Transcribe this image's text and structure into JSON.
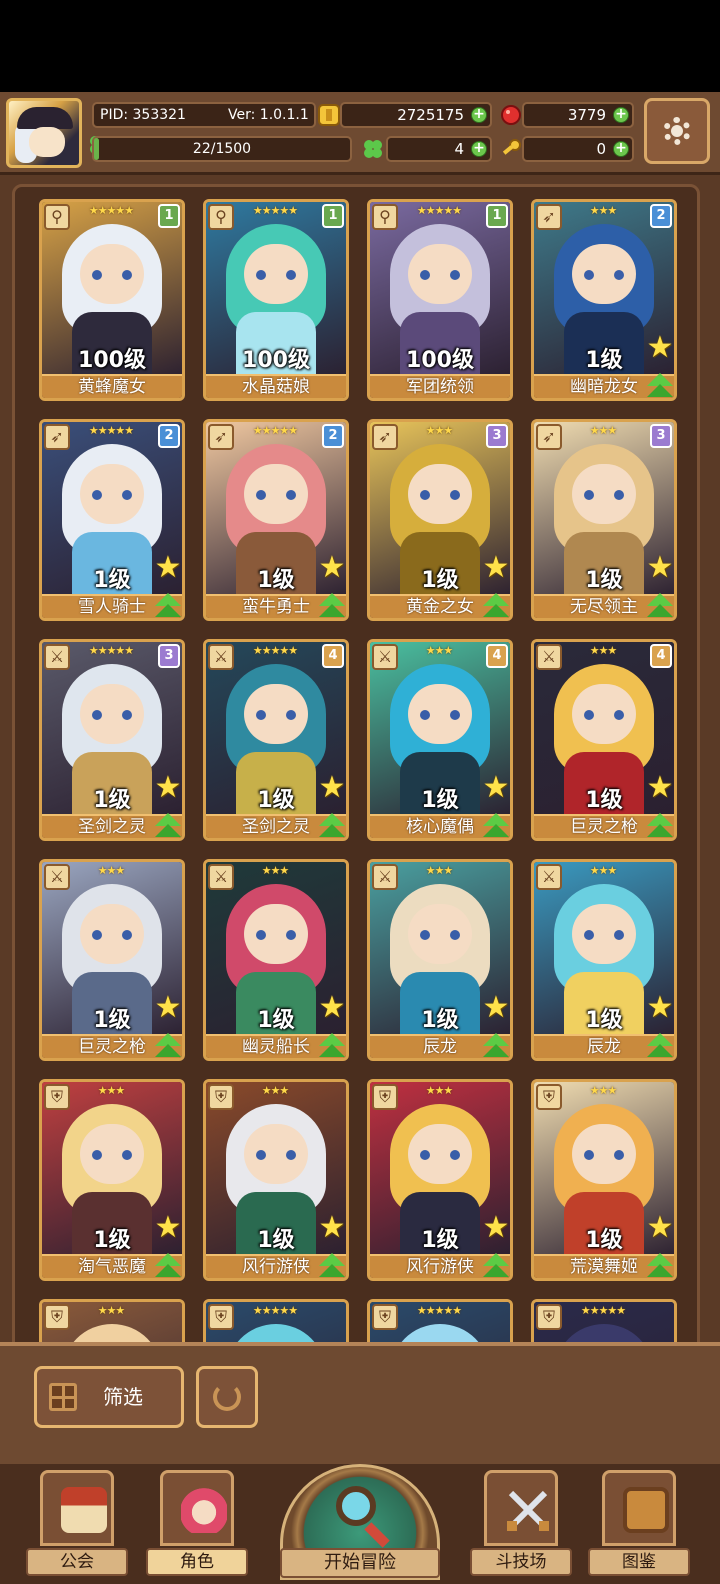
{
  "player": {
    "pid": "PID: 353321",
    "version": "Ver: 1.0.1.1",
    "level_progress": "22/1500",
    "level_fraction": 0.0147
  },
  "resources": {
    "gold": "2725175",
    "ruby": "3779",
    "clover": "4",
    "key": "0"
  },
  "colors": {
    "tier1": "#6aa84f",
    "tier2": "#4a8fd6",
    "tier3": "#9b7bd0",
    "tier4": "#d9a24e",
    "card_border": "#d9a24e",
    "name_plate": "#c98a3d"
  },
  "heroes": [
    {
      "stars": "★★★★★",
      "tier": "1",
      "level": "100级",
      "name": "黄蜂魔女",
      "weapon": "wand-icon",
      "art": [
        "#e9eef5",
        "#2e2a3c",
        "#d7a246"
      ]
    },
    {
      "stars": "★★★★★",
      "tier": "1",
      "level": "100级",
      "name": "水晶菇娘",
      "weapon": "wand-icon",
      "art": [
        "#47c9b5",
        "#a8e4ef",
        "#2f7aa0"
      ]
    },
    {
      "stars": "★★★★★",
      "tier": "1",
      "level": "100级",
      "name": "军团统领",
      "weapon": "wand-icon",
      "art": [
        "#c4c0dc",
        "#5b4a7a",
        "#7a6aa0"
      ]
    },
    {
      "stars": "★★★",
      "tier": "2",
      "level": "1级",
      "name": "幽暗龙女",
      "weapon": "bow-icon",
      "art": [
        "#2d5fa8",
        "#1b2f55",
        "#3e7a8a"
      ],
      "up": true
    },
    {
      "stars": "★★★★★",
      "tier": "2",
      "level": "1级",
      "name": "雪人骑士",
      "weapon": "bow-icon",
      "art": [
        "#e8edf4",
        "#6ab7e0",
        "#3a4f7a"
      ],
      "up": true
    },
    {
      "stars": "★★★★★",
      "tier": "2",
      "level": "1级",
      "name": "蛮牛勇士",
      "weapon": "bow-icon",
      "art": [
        "#e58a8a",
        "#8a5a3a",
        "#f0c8a0"
      ],
      "up": true
    },
    {
      "stars": "★★★",
      "tier": "3",
      "level": "1级",
      "name": "黄金之女",
      "weapon": "bow-icon",
      "art": [
        "#d6ae3c",
        "#8a6a1c",
        "#e8c45a"
      ],
      "up": true
    },
    {
      "stars": "★★★",
      "tier": "3",
      "level": "1级",
      "name": "无尽领主",
      "weapon": "bow-icon",
      "art": [
        "#e6c48a",
        "#b08850",
        "#f0dcb0"
      ],
      "up": true
    },
    {
      "stars": "★★★★★",
      "tier": "3",
      "level": "1级",
      "name": "圣剑之灵",
      "weapon": "sword-icon",
      "art": [
        "#dfe6ee",
        "#c9a25a",
        "#5a5a6a"
      ],
      "up": true
    },
    {
      "stars": "★★★★★",
      "tier": "4",
      "level": "1级",
      "name": "圣剑之灵",
      "weapon": "sword-icon",
      "art": [
        "#2f8aa0",
        "#c7b04a",
        "#24485a"
      ],
      "up": true
    },
    {
      "stars": "★★★",
      "tier": "4",
      "level": "1级",
      "name": "核心魔偶",
      "weapon": "sword-icon",
      "art": [
        "#2fb0d6",
        "#1e3a4a",
        "#4ac0a0"
      ],
      "up": true
    },
    {
      "stars": "★★★",
      "tier": "4",
      "level": "1级",
      "name": "巨灵之枪",
      "weapon": "sword-icon",
      "art": [
        "#f0c050",
        "#b0252a",
        "#2a2a3a"
      ],
      "up": true
    },
    {
      "stars": "★★★",
      "tier": "",
      "level": "1级",
      "name": "巨灵之枪",
      "weapon": "sword-icon",
      "art": [
        "#dfe3ea",
        "#5a6a8a",
        "#9aa6c0"
      ],
      "up": true
    },
    {
      "stars": "★★★",
      "tier": "",
      "level": "1级",
      "name": "幽灵船长",
      "weapon": "sword-icon",
      "art": [
        "#d04a6a",
        "#3a8a60",
        "#1f3a3a"
      ],
      "up": true
    },
    {
      "stars": "★★★",
      "tier": "",
      "level": "1级",
      "name": "辰龙",
      "weapon": "sword-icon",
      "art": [
        "#ecdcc0",
        "#2a8ab0",
        "#4aa0a0"
      ],
      "up": true
    },
    {
      "stars": "★★★",
      "tier": "",
      "level": "1级",
      "name": "辰龙",
      "weapon": "sword-icon",
      "art": [
        "#6acfe0",
        "#f0d060",
        "#3a9ac0"
      ],
      "up": true
    },
    {
      "stars": "★★★",
      "tier": "",
      "level": "1级",
      "name": "淘气恶魔",
      "weapon": "shield-icon",
      "art": [
        "#f2d48a",
        "#5a3030",
        "#c04040"
      ],
      "up": true
    },
    {
      "stars": "★★★",
      "tier": "",
      "level": "1级",
      "name": "风行游侠",
      "weapon": "shield-icon",
      "art": [
        "#e8e8ec",
        "#2a6a50",
        "#8a4a2a"
      ],
      "up": true
    },
    {
      "stars": "★★★",
      "tier": "",
      "level": "1级",
      "name": "风行游侠",
      "weapon": "shield-icon",
      "art": [
        "#f0c050",
        "#2a2a40",
        "#c03040"
      ],
      "up": true
    },
    {
      "stars": "★★★",
      "tier": "",
      "level": "1级",
      "name": "荒漠舞姬",
      "weapon": "shield-icon",
      "art": [
        "#f0b050",
        "#c0402a",
        "#f0dcb0"
      ],
      "up": true
    },
    {
      "stars": "★★★",
      "tier": "",
      "level": "",
      "name": "",
      "weapon": "shield-icon",
      "art": [
        "#f0d0a0",
        "#d06060",
        "#8a5a3a"
      ]
    },
    {
      "stars": "★★★★★",
      "tier": "",
      "level": "",
      "name": "",
      "weapon": "shield-icon",
      "art": [
        "#6acfe0",
        "#2a6a90",
        "#2a4a6a"
      ]
    },
    {
      "stars": "★★★★★",
      "tier": "",
      "level": "",
      "name": "",
      "weapon": "shield-icon",
      "art": [
        "#9ad8f0",
        "#3a6a90",
        "#2a4a6a"
      ]
    },
    {
      "stars": "★★★★★",
      "tier": "",
      "level": "",
      "name": "",
      "weapon": "shield-icon",
      "art": [
        "#3a3a6a",
        "#6a5a9a",
        "#2a2a4a"
      ]
    }
  ],
  "filter": {
    "label": "筛选"
  },
  "nav": {
    "guild": "公会",
    "characters": "角色",
    "adventure": "开始冒险",
    "arena": "斗技场",
    "codex": "图鉴"
  }
}
